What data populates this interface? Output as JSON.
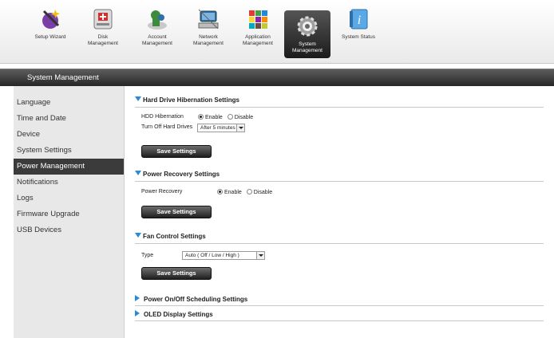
{
  "toolbar": {
    "items": [
      {
        "label": "Setup Wizard",
        "icon": "wand-icon"
      },
      {
        "label": "Disk\nManagement",
        "icon": "disk-icon"
      },
      {
        "label": "Account\nManagement",
        "icon": "account-icon"
      },
      {
        "label": "Network\nManagement",
        "icon": "network-icon"
      },
      {
        "label": "Application\nManagement",
        "icon": "application-icon"
      },
      {
        "label": "System\nManagement",
        "icon": "system-gear-icon"
      },
      {
        "label": "System Status",
        "icon": "info-icon"
      }
    ],
    "active_index": 5
  },
  "section_title": "System Management",
  "sidebar": {
    "items": [
      {
        "label": "Language"
      },
      {
        "label": "Time and Date"
      },
      {
        "label": "Device"
      },
      {
        "label": "System Settings"
      },
      {
        "label": "Power Management"
      },
      {
        "label": "Notifications"
      },
      {
        "label": "Logs"
      },
      {
        "label": "Firmware Upgrade"
      },
      {
        "label": "USB Devices"
      }
    ],
    "active_index": 4
  },
  "hibernation": {
    "title": "Hard Drive Hibernation Settings",
    "hdd_label": "HDD Hibernation",
    "enable_label": "Enable",
    "disable_label": "Disable",
    "selected": "Enable",
    "turn_off_label": "Turn Off Hard Drives",
    "turn_off_value": "After 5 minutes",
    "save_label": "Save Settings"
  },
  "power_recovery": {
    "title": "Power Recovery Settings",
    "label": "Power Recovery",
    "enable_label": "Enable",
    "disable_label": "Disable",
    "selected": "Enable",
    "save_label": "Save Settings"
  },
  "fan": {
    "title": "Fan Control Settings",
    "type_label": "Type",
    "type_value": "Auto ( Off / Low / High )",
    "save_label": "Save Settings"
  },
  "collapsed": {
    "schedule_title": "Power On/Off Scheduling Settings",
    "oled_title": "OLED Display Settings"
  },
  "colors": {
    "accent_blue": "#2a8ad8",
    "dark_bar": "#262626",
    "sidebar_bg": "#e8e8e8"
  }
}
